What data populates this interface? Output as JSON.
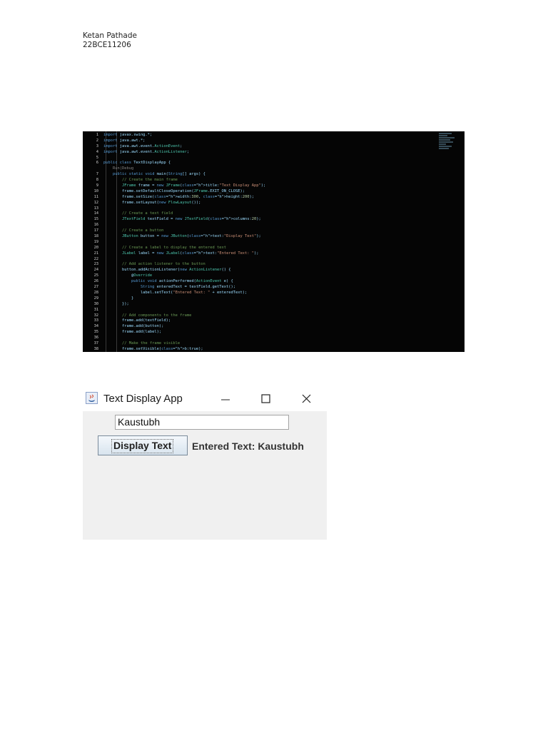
{
  "header": {
    "name": "Ketan Pathade",
    "id": "22BCE11206"
  },
  "code_screenshot": {
    "line_numbers": [
      "1",
      "2",
      "3",
      "4",
      "5",
      "6",
      "",
      "7",
      "8",
      "9",
      "10",
      "11",
      "12",
      "13",
      "14",
      "15",
      "16",
      "17",
      "18",
      "19",
      "20",
      "21",
      "22",
      "23",
      "24",
      "25",
      "26",
      "27",
      "28",
      "29",
      "30",
      "31",
      "32",
      "33",
      "34",
      "35",
      "36",
      "37",
      "38"
    ],
    "lines": [
      "import javax.swing.*;",
      "import java.awt.*;",
      "import java.awt.event.ActionEvent;",
      "import java.awt.event.ActionListener;",
      "",
      "public class TextDisplayApp {",
      "    Run|Debug",
      "    public static void main(String[] args) {",
      "        // Create the main frame",
      "        JFrame frame = new JFrame(title:\"Text Display App\");",
      "        frame.setDefaultCloseOperation(JFrame.EXIT_ON_CLOSE);",
      "        frame.setSize(width:300, height:200);",
      "        frame.setLayout(new FlowLayout());",
      "",
      "        // Create a text field",
      "        JTextField textField = new JTextField(columns:20);",
      "",
      "        // Create a button",
      "        JButton button = new JButton(text:\"Display Text\");",
      "",
      "        // Create a label to display the entered text",
      "        JLabel label = new JLabel(text:\"Entered Text: \");",
      "",
      "        // Add action listener to the button",
      "        button.addActionListener(new ActionListener() {",
      "            @Override",
      "            public void actionPerformed(ActionEvent e) {",
      "                String enteredText = textField.getText();",
      "                label.setText(\"Entered Text: \" + enteredText);",
      "            }",
      "        });",
      "",
      "        // Add components to the frame",
      "        frame.add(textField);",
      "        frame.add(button);",
      "        frame.add(label);",
      "",
      "        // Make the frame visible",
      "        frame.setVisible(b:true);"
    ]
  },
  "app_window": {
    "title": "Text Display App",
    "minimize_glyph": "—",
    "maximize_glyph": "☐",
    "close_glyph": "✕",
    "text_field_value": "Kaustubh",
    "button_label": "Display Text",
    "label_text": "Entered Text: Kaustubh",
    "icons": [
      "java-icon",
      "minimize-icon",
      "maximize-icon",
      "close-icon"
    ]
  }
}
